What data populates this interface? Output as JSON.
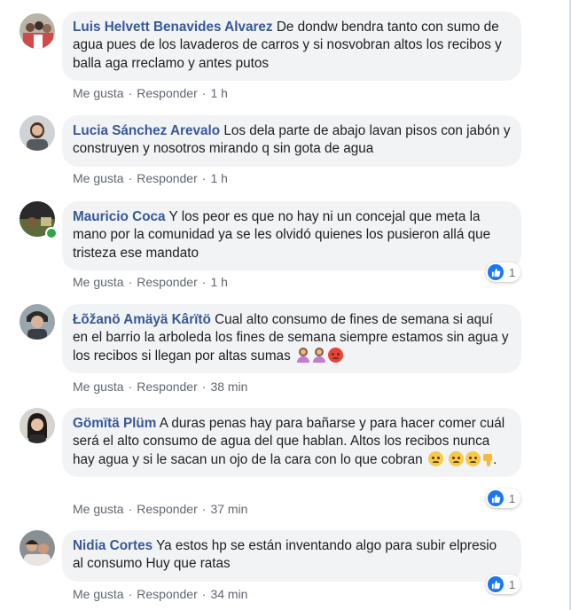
{
  "actions": {
    "like": "Me gusta",
    "reply": "Responder",
    "separator": "·"
  },
  "colors": {
    "author": "#385898",
    "bubble": "#f2f3f5",
    "meta": "#606770",
    "like_blue": "#1877f2",
    "online_green": "#31a24c"
  },
  "comments": [
    {
      "author": "Luis Helvett Benavides Alvarez",
      "text": "De dondw bendra tanto con sumo de agua pues de los lavaderos de carros y si nosvobran altos los recibos y balla aga rreclamo y antes putos",
      "time": "1 h"
    },
    {
      "author": "Lucia Sánchez Arevalo",
      "text": "Los dela parte de abajo lavan pisos con jabón y construyen y nosotros mirando q sin gota de agua",
      "time": "1 h"
    },
    {
      "author": "Mauricio Coca",
      "text": "Y los peor es que no hay ni un concejal que meta la mano por la comunidad ya se les olvidó quienes los pusieron allá que tristeza ese mandato",
      "time": "1 h",
      "reactions": "1",
      "online": true
    },
    {
      "author": "Łõžanö Amäyä Kârïtö",
      "text": "Cual alto consumo de fines de semana si aquí en el barrio la arboleda los fines de semana siempre estamos sin agua y los recibos si llegan por altas sumas",
      "emoji_names": [
        "woman-facepalming",
        "woman-facepalming",
        "angry-face"
      ],
      "time": "38 min"
    },
    {
      "author": "Gömïtä Plüm",
      "text": "A duras penas hay para bañarse y para hacer comer cuál será el alto consumo de agua del que hablan. Altos los recibos nunca hay agua y si le sacan un ojo de la cara con lo que cobran",
      "emoji_names": [
        "sad-face",
        "sad-face",
        "sad-face",
        "thumbs-down"
      ],
      "trailing": ".",
      "time": "37 min",
      "reactions": "1"
    },
    {
      "author": "Nidia Cortes",
      "text": "Ya estos hp se están inventando algo para subir elpresio al consumo Huy que ratas",
      "time": "34 min",
      "reactions": "1"
    }
  ]
}
